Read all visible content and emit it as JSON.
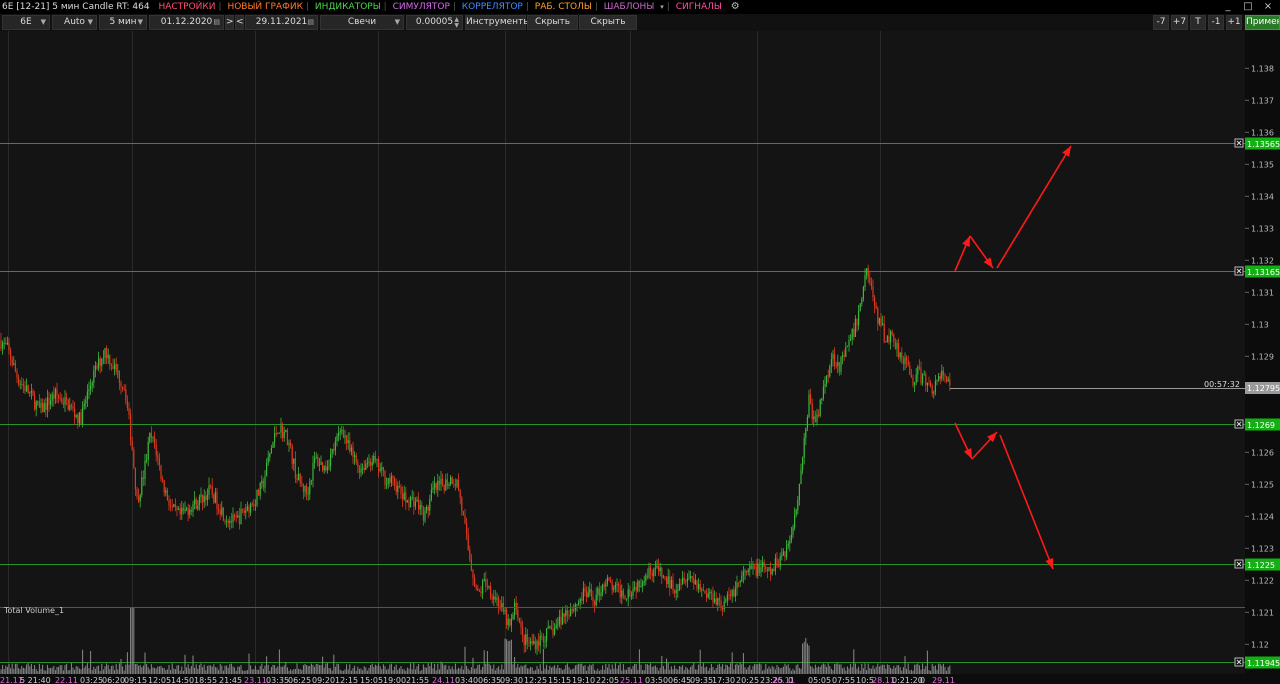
{
  "menubar": {
    "title": "6E [12-21] 5 мин Candle RT: 464",
    "items": [
      {
        "label": "НАСТРОЙКИ",
        "color": "#ff4f6f"
      },
      {
        "label": "НОВЫЙ ГРАФИК",
        "color": "#ff7b2e"
      },
      {
        "label": "ИНДИКАТОРЫ",
        "color": "#4fd24f"
      },
      {
        "label": "СИМУЛЯТОР",
        "color": "#d16ce8"
      },
      {
        "label": "КОРРЕЛЯТОР",
        "color": "#3f8dff"
      },
      {
        "label": "РАБ. СТОЛЫ",
        "color": "#ff9f2e"
      },
      {
        "label": "ШАБЛОНЫ",
        "color": "#c86bc8"
      },
      {
        "label": "СИГНАЛЫ",
        "color": "#ff4fa8"
      }
    ],
    "window_buttons": [
      "_",
      "□",
      "×"
    ]
  },
  "toolbar": {
    "symbol": "6E",
    "scale": "Auto",
    "timeframe": "5 мин",
    "date_from": "01.12.2020",
    "next_label": ">",
    "prev_label": "<",
    "date_to": "29.11.2021",
    "chart_type": "Свечи",
    "tick_size": "0.00005",
    "instruments_label": "Инструменты",
    "hide_drawings_label": "Скрыть рис.",
    "hide_lines_label": "Скрыть линии",
    "shift_buttons": [
      "-7",
      "+7",
      "T",
      "-1",
      "+1"
    ],
    "apply_label": "Применить"
  },
  "chart_data": {
    "type": "candlestick",
    "symbol": "6E",
    "timeframe": "5 мин",
    "price_axis": {
      "ticks": [
        "1.138",
        "1.137",
        "1.136",
        "1.135",
        "1.134",
        "1.133",
        "1.132",
        "1.131",
        "1.13",
        "1.129",
        "1.126",
        "1.125",
        "1.124",
        "1.123",
        "1.122",
        "1.121",
        "1.12"
      ],
      "range": [
        1.1193,
        1.1391
      ]
    },
    "time_labels": [
      "21.11",
      "5 21:40",
      "22.11",
      "03:25",
      "06:20",
      "09:15",
      "12:05",
      "14:50",
      "18:55",
      "21:45",
      "23.11",
      "03:35",
      "06:25",
      "09:20",
      "12:15",
      "15:05",
      "19:00",
      "21:55",
      "24.11",
      "03:40",
      "06:35",
      "09:30",
      "12:25",
      "15:15",
      "19:10",
      "22:05",
      "25.11",
      "03:50",
      "06:45",
      "09:35",
      "17:30",
      "20:25",
      "23:25",
      "26.11",
      "0",
      "05:05",
      "07:55",
      "10:5",
      "28.11",
      "0:21:20",
      "0",
      "29.11"
    ],
    "levels": [
      {
        "price": "1.13565",
        "color": "#2fa82f"
      },
      {
        "price": "1.13165",
        "color": "#2fa82f"
      },
      {
        "price": "1.1269",
        "color": "#2fa82f"
      },
      {
        "price": "1.1225",
        "color": "#2fa82f"
      },
      {
        "price": "1.11945",
        "color": "#2fa82f"
      }
    ],
    "current_price": "1.12795",
    "countdown": "00:57:32",
    "volume_label": "Total Volume_1",
    "price_path": [
      [
        0,
        1.1295
      ],
      [
        8,
        1.1292
      ],
      [
        18,
        1.1283
      ],
      [
        28,
        1.1279
      ],
      [
        40,
        1.1273
      ],
      [
        55,
        1.1278
      ],
      [
        68,
        1.1275
      ],
      [
        80,
        1.127
      ],
      [
        92,
        1.1283
      ],
      [
        105,
        1.1292
      ],
      [
        115,
        1.1286
      ],
      [
        125,
        1.128
      ],
      [
        132,
        1.1262
      ],
      [
        137,
        1.1245
      ],
      [
        143,
        1.1252
      ],
      [
        150,
        1.1265
      ],
      [
        155,
        1.1262
      ],
      [
        163,
        1.125
      ],
      [
        172,
        1.1242
      ],
      [
        180,
        1.124
      ],
      [
        190,
        1.1243
      ],
      [
        200,
        1.1245
      ],
      [
        210,
        1.1248
      ],
      [
        218,
        1.1244
      ],
      [
        225,
        1.124
      ],
      [
        235,
        1.1238
      ],
      [
        245,
        1.1242
      ],
      [
        255,
        1.1245
      ],
      [
        263,
        1.125
      ],
      [
        270,
        1.126
      ],
      [
        278,
        1.1268
      ],
      [
        287,
        1.1265
      ],
      [
        297,
        1.1252
      ],
      [
        307,
        1.1247
      ],
      [
        315,
        1.1258
      ],
      [
        325,
        1.1255
      ],
      [
        335,
        1.1262
      ],
      [
        342,
        1.1268
      ],
      [
        350,
        1.126
      ],
      [
        360,
        1.1255
      ],
      [
        372,
        1.1258
      ],
      [
        385,
        1.1252
      ],
      [
        395,
        1.125
      ],
      [
        405,
        1.1245
      ],
      [
        415,
        1.1245
      ],
      [
        425,
        1.124
      ],
      [
        433,
        1.1248
      ],
      [
        443,
        1.125
      ],
      [
        452,
        1.1252
      ],
      [
        458,
        1.125
      ],
      [
        463,
        1.124
      ],
      [
        468,
        1.123
      ],
      [
        473,
        1.1222
      ],
      [
        478,
        1.1215
      ],
      [
        485,
        1.122
      ],
      [
        490,
        1.1217
      ],
      [
        497,
        1.1214
      ],
      [
        503,
        1.121
      ],
      [
        510,
        1.1205
      ],
      [
        516,
        1.1213
      ],
      [
        522,
        1.1202
      ],
      [
        530,
        1.12
      ],
      [
        538,
        1.1201
      ],
      [
        546,
        1.1203
      ],
      [
        555,
        1.1205
      ],
      [
        565,
        1.121
      ],
      [
        575,
        1.1212
      ],
      [
        585,
        1.1216
      ],
      [
        595,
        1.1214
      ],
      [
        605,
        1.122
      ],
      [
        615,
        1.1217
      ],
      [
        625,
        1.1216
      ],
      [
        635,
        1.1218
      ],
      [
        645,
        1.1222
      ],
      [
        655,
        1.1224
      ],
      [
        665,
        1.122
      ],
      [
        675,
        1.1218
      ],
      [
        685,
        1.1222
      ],
      [
        695,
        1.122
      ],
      [
        705,
        1.1216
      ],
      [
        715,
        1.1215
      ],
      [
        723,
        1.1212
      ],
      [
        730,
        1.1215
      ],
      [
        740,
        1.122
      ],
      [
        750,
        1.1223
      ],
      [
        760,
        1.1224
      ],
      [
        770,
        1.1222
      ],
      [
        780,
        1.1227
      ],
      [
        790,
        1.1232
      ],
      [
        797,
        1.1245
      ],
      [
        803,
        1.126
      ],
      [
        809,
        1.1277
      ],
      [
        815,
        1.1268
      ],
      [
        821,
        1.1276
      ],
      [
        827,
        1.1285
      ],
      [
        833,
        1.129
      ],
      [
        840,
        1.1287
      ],
      [
        847,
        1.1292
      ],
      [
        854,
        1.1298
      ],
      [
        860,
        1.1305
      ],
      [
        866,
        1.1318
      ],
      [
        871,
        1.1312
      ],
      [
        876,
        1.1303
      ],
      [
        881,
        1.13
      ],
      [
        886,
        1.1295
      ],
      [
        892,
        1.1297
      ],
      [
        898,
        1.1292
      ],
      [
        905,
        1.1289
      ],
      [
        912,
        1.1282
      ],
      [
        918,
        1.1285
      ],
      [
        925,
        1.1282
      ],
      [
        932,
        1.128
      ],
      [
        938,
        1.1282
      ],
      [
        944,
        1.1285
      ],
      [
        950,
        1.12795
      ]
    ],
    "annotations": "red arrows indicating breakout scenarios above 1.13165 and below 1.1269"
  }
}
